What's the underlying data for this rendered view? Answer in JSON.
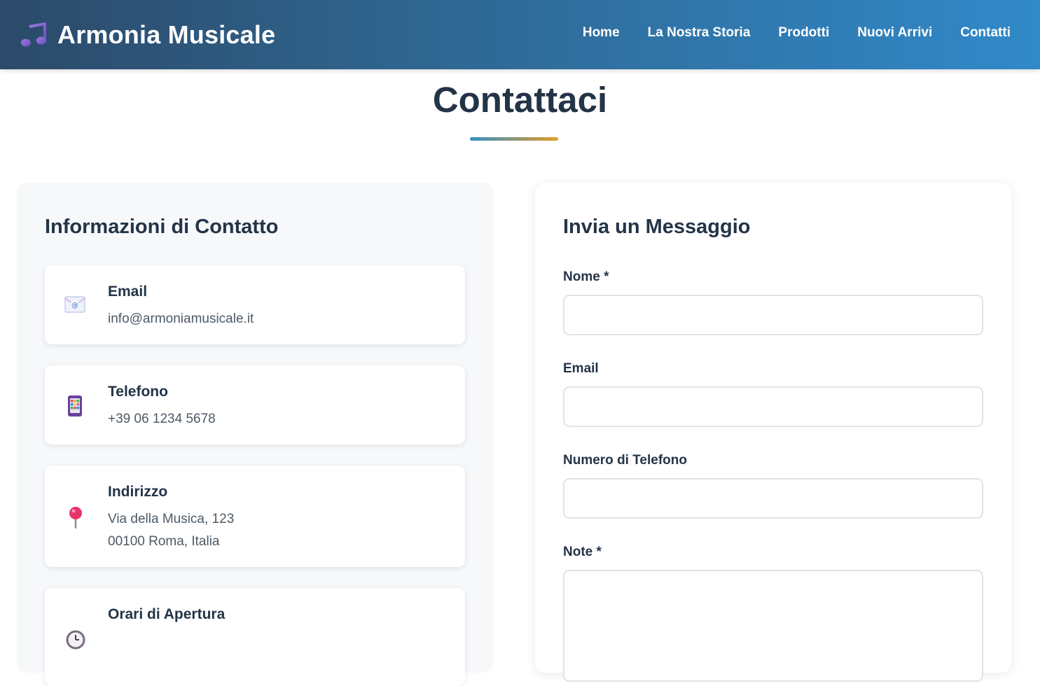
{
  "header": {
    "brand": "Armonia Musicale",
    "logo_icon": "music-note-icon",
    "nav": [
      "Home",
      "La Nostra Storia",
      "Prodotti",
      "Nuovi Arrivi",
      "Contatti"
    ]
  },
  "page": {
    "title": "Contattaci"
  },
  "info": {
    "heading": "Informazioni di Contatto",
    "cards": [
      {
        "icon": "email-icon",
        "title": "Email",
        "lines": [
          "info@armoniamusicale.it"
        ]
      },
      {
        "icon": "phone-icon",
        "title": "Telefono",
        "lines": [
          "+39 06 1234 5678"
        ]
      },
      {
        "icon": "pin-icon",
        "title": "Indirizzo",
        "lines": [
          "Via della Musica, 123",
          "00100 Roma, Italia"
        ]
      },
      {
        "icon": "clock-icon",
        "title": "Orari di Apertura",
        "lines": []
      }
    ]
  },
  "form": {
    "heading": "Invia un Messaggio",
    "fields": [
      {
        "label": "Nome *",
        "value": "",
        "placeholder": ""
      },
      {
        "label": "Email",
        "value": "",
        "placeholder": ""
      },
      {
        "label": "Numero di Telefono",
        "value": "",
        "placeholder": ""
      },
      {
        "label": "Note *",
        "value": "",
        "placeholder": ""
      }
    ]
  },
  "colors": {
    "header_gradient_start": "#2c4a69",
    "header_gradient_end": "#3189c9",
    "heading_text": "#233447",
    "accent_blue": "#3390c6",
    "accent_orange": "#e59d26"
  }
}
